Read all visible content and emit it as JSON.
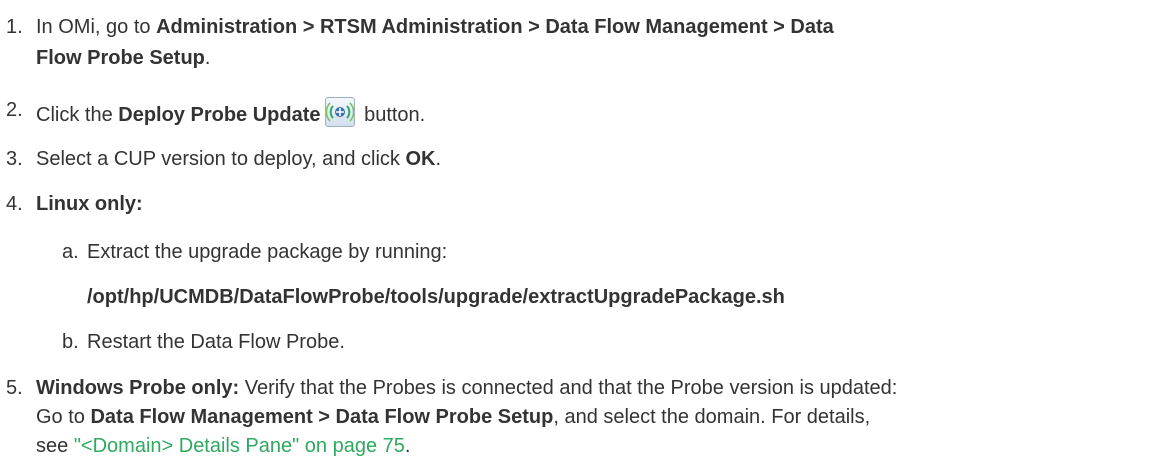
{
  "steps": {
    "s1": {
      "num": "1.",
      "pre": "In OMi, go to ",
      "path1": "Administration > RTSM Administration > Data Flow Management > Data",
      "path2": "Flow Probe Setup",
      "post": "."
    },
    "s2": {
      "num": "2.",
      "pre": "Click the ",
      "button_name": "Deploy Probe Update",
      "post": " button."
    },
    "s3": {
      "num": "3.",
      "pre": "Select a CUP version to deploy, and click ",
      "ok": "OK",
      "post": "."
    },
    "s4": {
      "num": "4.",
      "label": "Linux only:",
      "a_num": "a.",
      "a_text": "Extract the upgrade package by running:",
      "a_cmd": "/opt/hp/UCMDB/DataFlowProbe/tools/upgrade/extractUpgradePackage.sh",
      "b_num": "b.",
      "b_text": "Restart the Data Flow Probe."
    },
    "s5": {
      "num": "5.",
      "label": "Windows Probe only:",
      "text1": " Verify that the Probes is connected and that the Probe version is updated:",
      "pre2": "Go to ",
      "path": "Data Flow Management > Data Flow Probe Setup",
      "post2": ", and select the domain. For details,",
      "pre3": "see ",
      "link": "\"<Domain> Details Pane\" on page 75",
      "post3": "."
    }
  },
  "colors": {
    "text": "#333333",
    "link": "#2fa860"
  },
  "icons": {
    "deploy_probe_update": "deploy-probe-update-icon"
  }
}
